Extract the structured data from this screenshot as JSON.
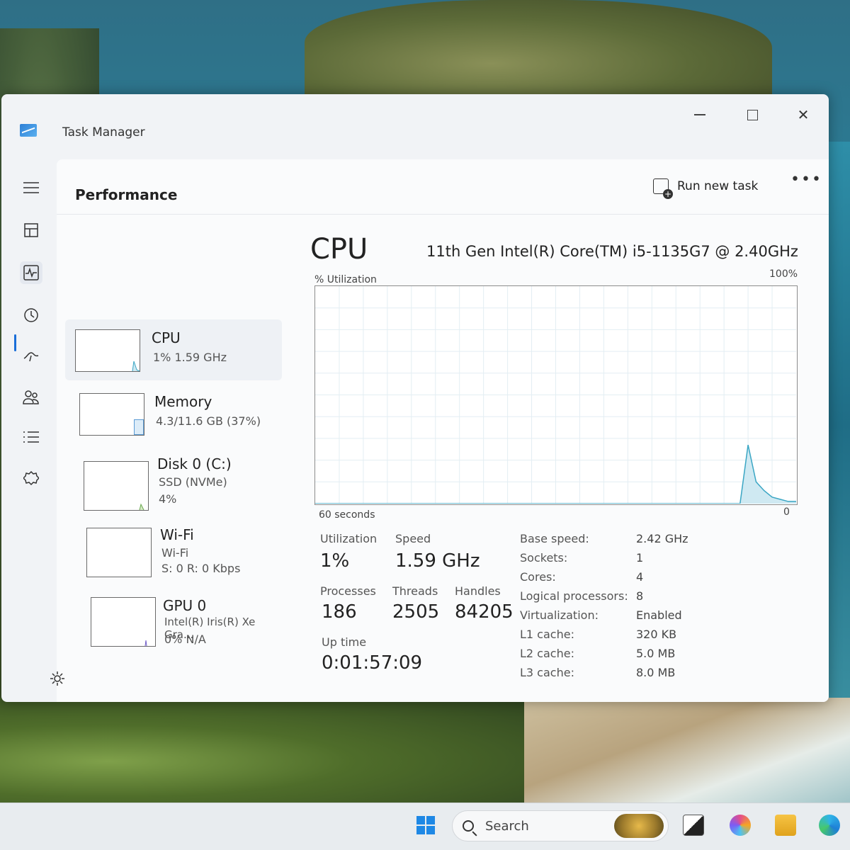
{
  "window": {
    "title": "Task Manager",
    "controls": {
      "minimize": "–",
      "maximize": "□",
      "close": "✕"
    }
  },
  "nav": {
    "items": [
      {
        "name": "menu",
        "icon": "hamburger-icon"
      },
      {
        "name": "processes",
        "icon": "processes-icon"
      },
      {
        "name": "performance",
        "icon": "performance-icon",
        "active": true
      },
      {
        "name": "app-history",
        "icon": "history-icon"
      },
      {
        "name": "startup-apps",
        "icon": "startup-icon"
      },
      {
        "name": "users",
        "icon": "users-icon"
      },
      {
        "name": "details",
        "icon": "details-icon"
      },
      {
        "name": "services",
        "icon": "services-icon"
      },
      {
        "name": "settings",
        "icon": "gear-icon"
      }
    ]
  },
  "header": {
    "page_title": "Performance",
    "run_new_task": "Run new task",
    "more": "•••"
  },
  "devices": [
    {
      "name": "CPU",
      "line1": "1% 1.59 GHz",
      "line2": ""
    },
    {
      "name": "Memory",
      "line1": "4.3/11.6 GB (37%)",
      "line2": ""
    },
    {
      "name": "Disk 0 (C:)",
      "line1": "SSD (NVMe)",
      "line2": "4%"
    },
    {
      "name": "Wi-Fi",
      "line1": "Wi-Fi",
      "line2": "S: 0 R: 0 Kbps"
    },
    {
      "name": "GPU 0",
      "line1": "Intel(R) Iris(R) Xe Gra...",
      "line2": "0% N/A"
    }
  ],
  "detail": {
    "title": "CPU",
    "model": "11th Gen Intel(R) Core(TM) i5-1135G7 @ 2.40GHz",
    "util_label": "% Utilization",
    "max_label": "100%",
    "time_label": "60 seconds",
    "min_label": "0",
    "stats": {
      "utilization_label": "Utilization",
      "utilization": "1%",
      "speed_label": "Speed",
      "speed": "1.59 GHz",
      "processes_label": "Processes",
      "processes": "186",
      "threads_label": "Threads",
      "threads": "2505",
      "handles_label": "Handles",
      "handles": "84205",
      "uptime_label": "Up time",
      "uptime": "0:01:57:09"
    },
    "specs": [
      {
        "key": "Base speed:",
        "value": "2.42 GHz"
      },
      {
        "key": "Sockets:",
        "value": "1"
      },
      {
        "key": "Cores:",
        "value": "4"
      },
      {
        "key": "Logical processors:",
        "value": "8"
      },
      {
        "key": "Virtualization:",
        "value": "Enabled"
      },
      {
        "key": "L1 cache:",
        "value": "320 KB"
      },
      {
        "key": "L2 cache:",
        "value": "5.0 MB"
      },
      {
        "key": "L3 cache:",
        "value": "8.0 MB"
      }
    ]
  },
  "chart_data": {
    "type": "area",
    "x": [
      0,
      1,
      2,
      3,
      4,
      5,
      6,
      7,
      8,
      9,
      10,
      11,
      12,
      13,
      14,
      15,
      16,
      17,
      18,
      19,
      20,
      21,
      22,
      23,
      24,
      25,
      26,
      27,
      28,
      29,
      30,
      31,
      32,
      33,
      34,
      35,
      36,
      37,
      38,
      39,
      40,
      41,
      42,
      43,
      44,
      45,
      46,
      47,
      48,
      49,
      50,
      51,
      52,
      53,
      54,
      55,
      56,
      57,
      58,
      59,
      60
    ],
    "series": [
      {
        "values": [
          0,
          0,
          0,
          0,
          0,
          0,
          0,
          0,
          0,
          0,
          0,
          0,
          0,
          0,
          0,
          0,
          0,
          0,
          0,
          0,
          0,
          0,
          0,
          0,
          0,
          0,
          0,
          0,
          0,
          0,
          0,
          0,
          0,
          0,
          0,
          0,
          0,
          0,
          0,
          0,
          0,
          0,
          0,
          0,
          0,
          0,
          0,
          0,
          0,
          0,
          0,
          0,
          0,
          0,
          27,
          10,
          6,
          3,
          2,
          1,
          1
        ]
      }
    ],
    "ylim": [
      0,
      100
    ],
    "xlim": [
      0,
      60
    ],
    "grid": true
  },
  "taskbar": {
    "search_placeholder": "Search"
  },
  "colors": {
    "accent": "#1a6ed8",
    "graph_line": "#3aa6c4",
    "graph_fill": "#cfe9f2"
  }
}
